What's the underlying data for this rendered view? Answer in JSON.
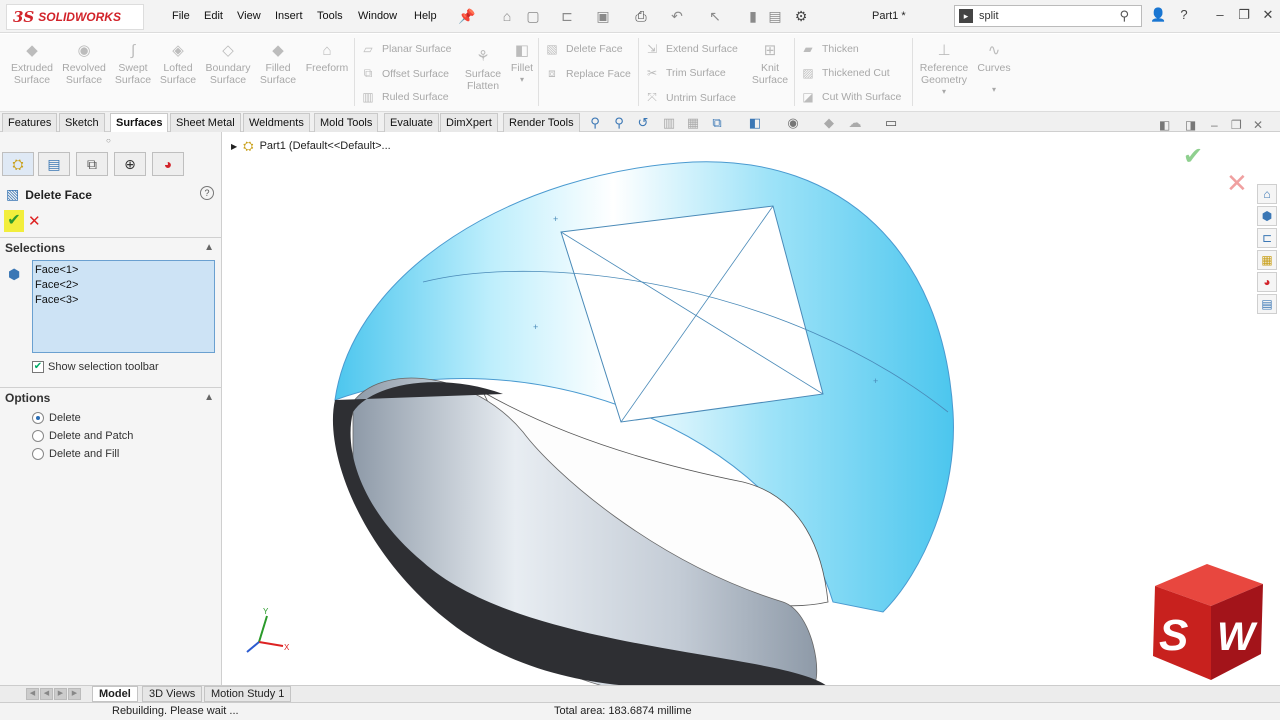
{
  "app": {
    "logo_ds": "3S",
    "logo_text": "SOLIDWORKS",
    "document_title": "Part1 *"
  },
  "menu": [
    "File",
    "Edit",
    "View",
    "Insert",
    "Tools",
    "Window",
    "Help"
  ],
  "search": {
    "value": "split"
  },
  "command_manager": {
    "big": [
      {
        "label": "Extruded\nSurface"
      },
      {
        "label": "Revolved\nSurface"
      },
      {
        "label": "Swept\nSurface"
      },
      {
        "label": "Lofted\nSurface"
      },
      {
        "label": "Boundary\nSurface"
      },
      {
        "label": "Filled\nSurface"
      },
      {
        "label": "Freeform"
      }
    ],
    "col1": [
      "Planar Surface",
      "Offset Surface",
      "Ruled Surface"
    ],
    "surface_flatten": "Surface\nFlatten",
    "fillet": "Fillet",
    "col2": [
      "Delete Face",
      "Replace Face"
    ],
    "col3": [
      "Extend Surface",
      "Trim Surface",
      "Untrim Surface"
    ],
    "knit": "Knit\nSurface",
    "col4": [
      "Thicken",
      "Thickened Cut",
      "Cut With Surface"
    ],
    "ref_geom": "Reference\nGeometry",
    "curves": "Curves"
  },
  "tabs": [
    "Features",
    "Sketch",
    "Surfaces",
    "Sheet Metal",
    "Weldments",
    "Mold Tools",
    "Evaluate",
    "DimXpert",
    "Render Tools"
  ],
  "active_tab": "Surfaces",
  "property_manager": {
    "title": "Delete Face",
    "help": "?",
    "selections_header": "Selections",
    "selections": [
      "Face<1>",
      "Face<2>",
      "Face<3>"
    ],
    "show_selection_toolbar": "Show selection toolbar",
    "options_header": "Options",
    "options": [
      {
        "label": "Delete",
        "selected": true
      },
      {
        "label": "Delete and Patch",
        "selected": false
      },
      {
        "label": "Delete and Fill",
        "selected": false
      }
    ]
  },
  "tree": {
    "label": "Part1  (Default<<Default>..."
  },
  "bottom_tabs": [
    "Model",
    "3D Views",
    "Motion Study 1"
  ],
  "status": {
    "left": "Rebuilding. Please wait ...",
    "center": "Total area: 183.6874 millime"
  },
  "colors": {
    "accent": "#3b77b5",
    "brand_red": "#d2232a",
    "surface_cyan": "#6fd3f3"
  }
}
